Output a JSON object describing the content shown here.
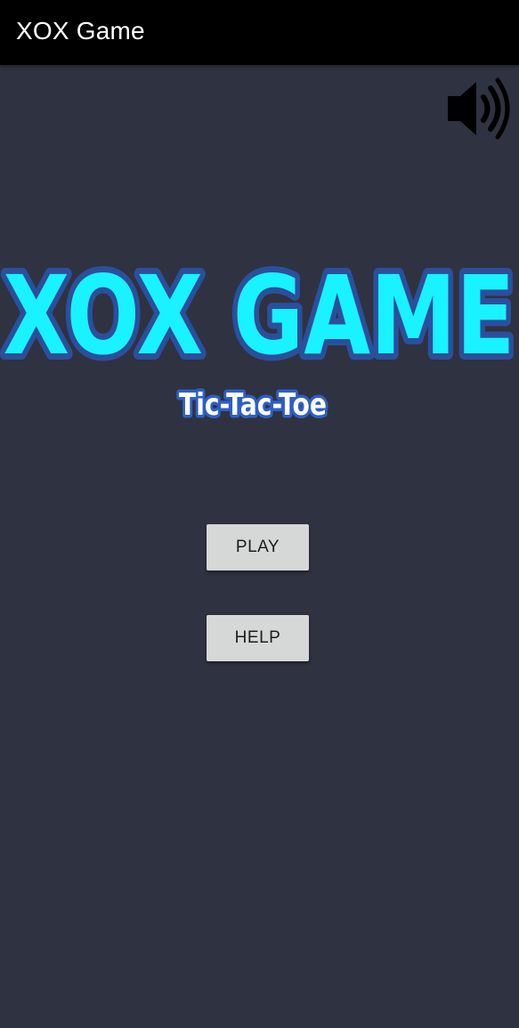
{
  "app_bar": {
    "title": "XOX Game"
  },
  "sound_toggle": {
    "icon": "speaker-volume-icon",
    "state": "on"
  },
  "logo": {
    "title": "XOX GAME",
    "subtitle": "Tic-Tac-Toe",
    "colors": {
      "fill": "#19f2ff",
      "outline": "#2c4f9c",
      "subtitle_fill": "#ffffff",
      "subtitle_outline": "#2f5fc4"
    }
  },
  "menu": {
    "play_label": "PLAY",
    "help_label": "HELP"
  },
  "colors": {
    "background": "#2f3240",
    "app_bar": "#000000",
    "button": "#d6d7d7",
    "button_text": "#1d1d1d"
  }
}
